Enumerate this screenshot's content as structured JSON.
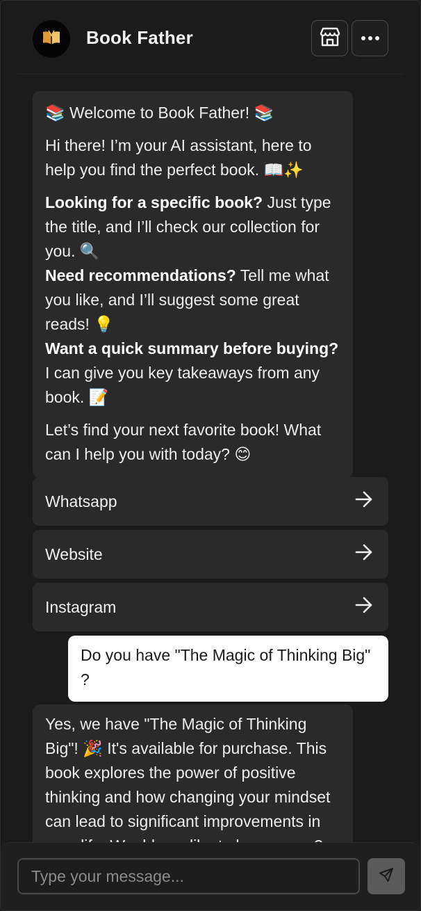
{
  "header": {
    "title": "Book Father",
    "store_icon": "storefront-icon",
    "more_icon": "ellipsis-icon"
  },
  "welcome": {
    "heading_prefix": "📚 ",
    "heading": "Welcome to Book Father!",
    "heading_suffix": " 📚",
    "intro": "Hi there! I’m your AI assistant, here to help you find the perfect book. 📖✨",
    "item1_bold": "Looking for a specific book?",
    "item1_text": " Just type the title, and I’ll check our collection for you. 🔍",
    "item2_bold": "Need recommendations?",
    "item2_text": " Tell me what you like, and I’ll suggest some great reads! 💡",
    "item3_bold": "Want a quick summary before buying?",
    "item3_text": " I can give you key takeaways from any book. 📝",
    "closing": "Let’s find your next favorite book! What can I help you with today? 😊"
  },
  "options": [
    {
      "label": "Whatsapp"
    },
    {
      "label": "Website"
    },
    {
      "label": "Instagram"
    }
  ],
  "user_message": "Do you have \"The Magic of Thinking Big\" ?",
  "bot_reply": "Yes, we have \"The Magic of Thinking Big\"! 🎉 It's available for purchase. This book explores the power of positive thinking and how changing your mindset can lead to significant improvements in your life. Would you like to know more?",
  "composer": {
    "placeholder": "Type your message...",
    "send_icon": "send-icon"
  },
  "colors": {
    "background": "#1b1b1b",
    "bubble_bot": "#2a2a2a",
    "bubble_user": "#ffffff",
    "send_button": "#5b5b5b"
  }
}
